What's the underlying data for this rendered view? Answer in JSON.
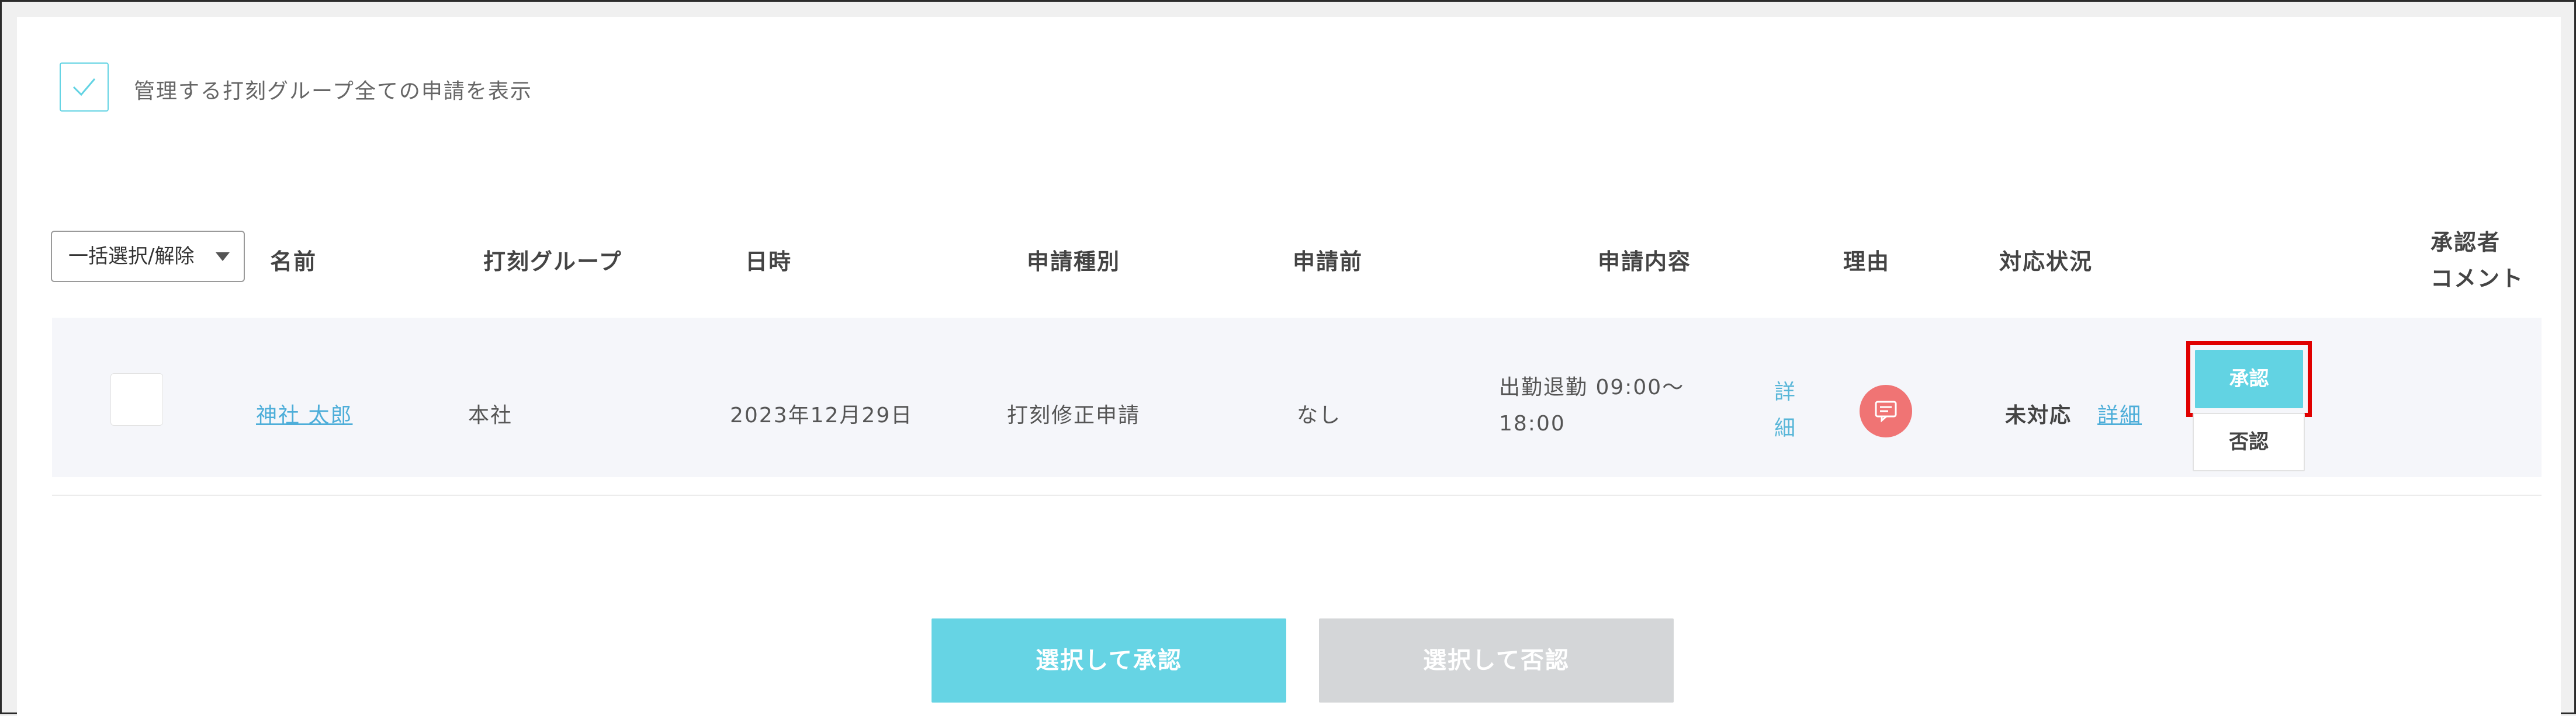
{
  "filter": {
    "show_all_label": "管理する打刻グループ全ての申請を表示",
    "checked": true
  },
  "table": {
    "bulk_select_label": "一括選択/解除",
    "headers": {
      "name": "名前",
      "group": "打刻グループ",
      "datetime": "日時",
      "type": "申請種別",
      "before": "申請前",
      "content": "申請内容",
      "reason": "理由",
      "status": "対応状況",
      "comment_line1": "承認者",
      "comment_line2": "コメント"
    },
    "rows": [
      {
        "name": "神社 太郎",
        "group": "本社",
        "date": "2023年12月29日",
        "type": "打刻修正申請",
        "before": "なし",
        "content_line1": "出勤退勤 09:00〜",
        "content_line2": "18:00",
        "content_detail_line1": "詳",
        "content_detail_line2": "細",
        "status": "未対応",
        "status_detail": "詳細",
        "approve_label": "承認",
        "reject_label": "否認"
      }
    ]
  },
  "actions": {
    "approve_selected": "選択して承認",
    "reject_selected": "選択して否認"
  },
  "colors": {
    "accent": "#62d3e3",
    "link": "#4eaed9",
    "reason_icon": "#f07474",
    "highlight": "#e00000",
    "disabled": "#d4d6d8"
  },
  "icons": {
    "checkbox_check": "check-icon",
    "reason": "comment-icon",
    "dropdown": "caret-down-icon"
  }
}
